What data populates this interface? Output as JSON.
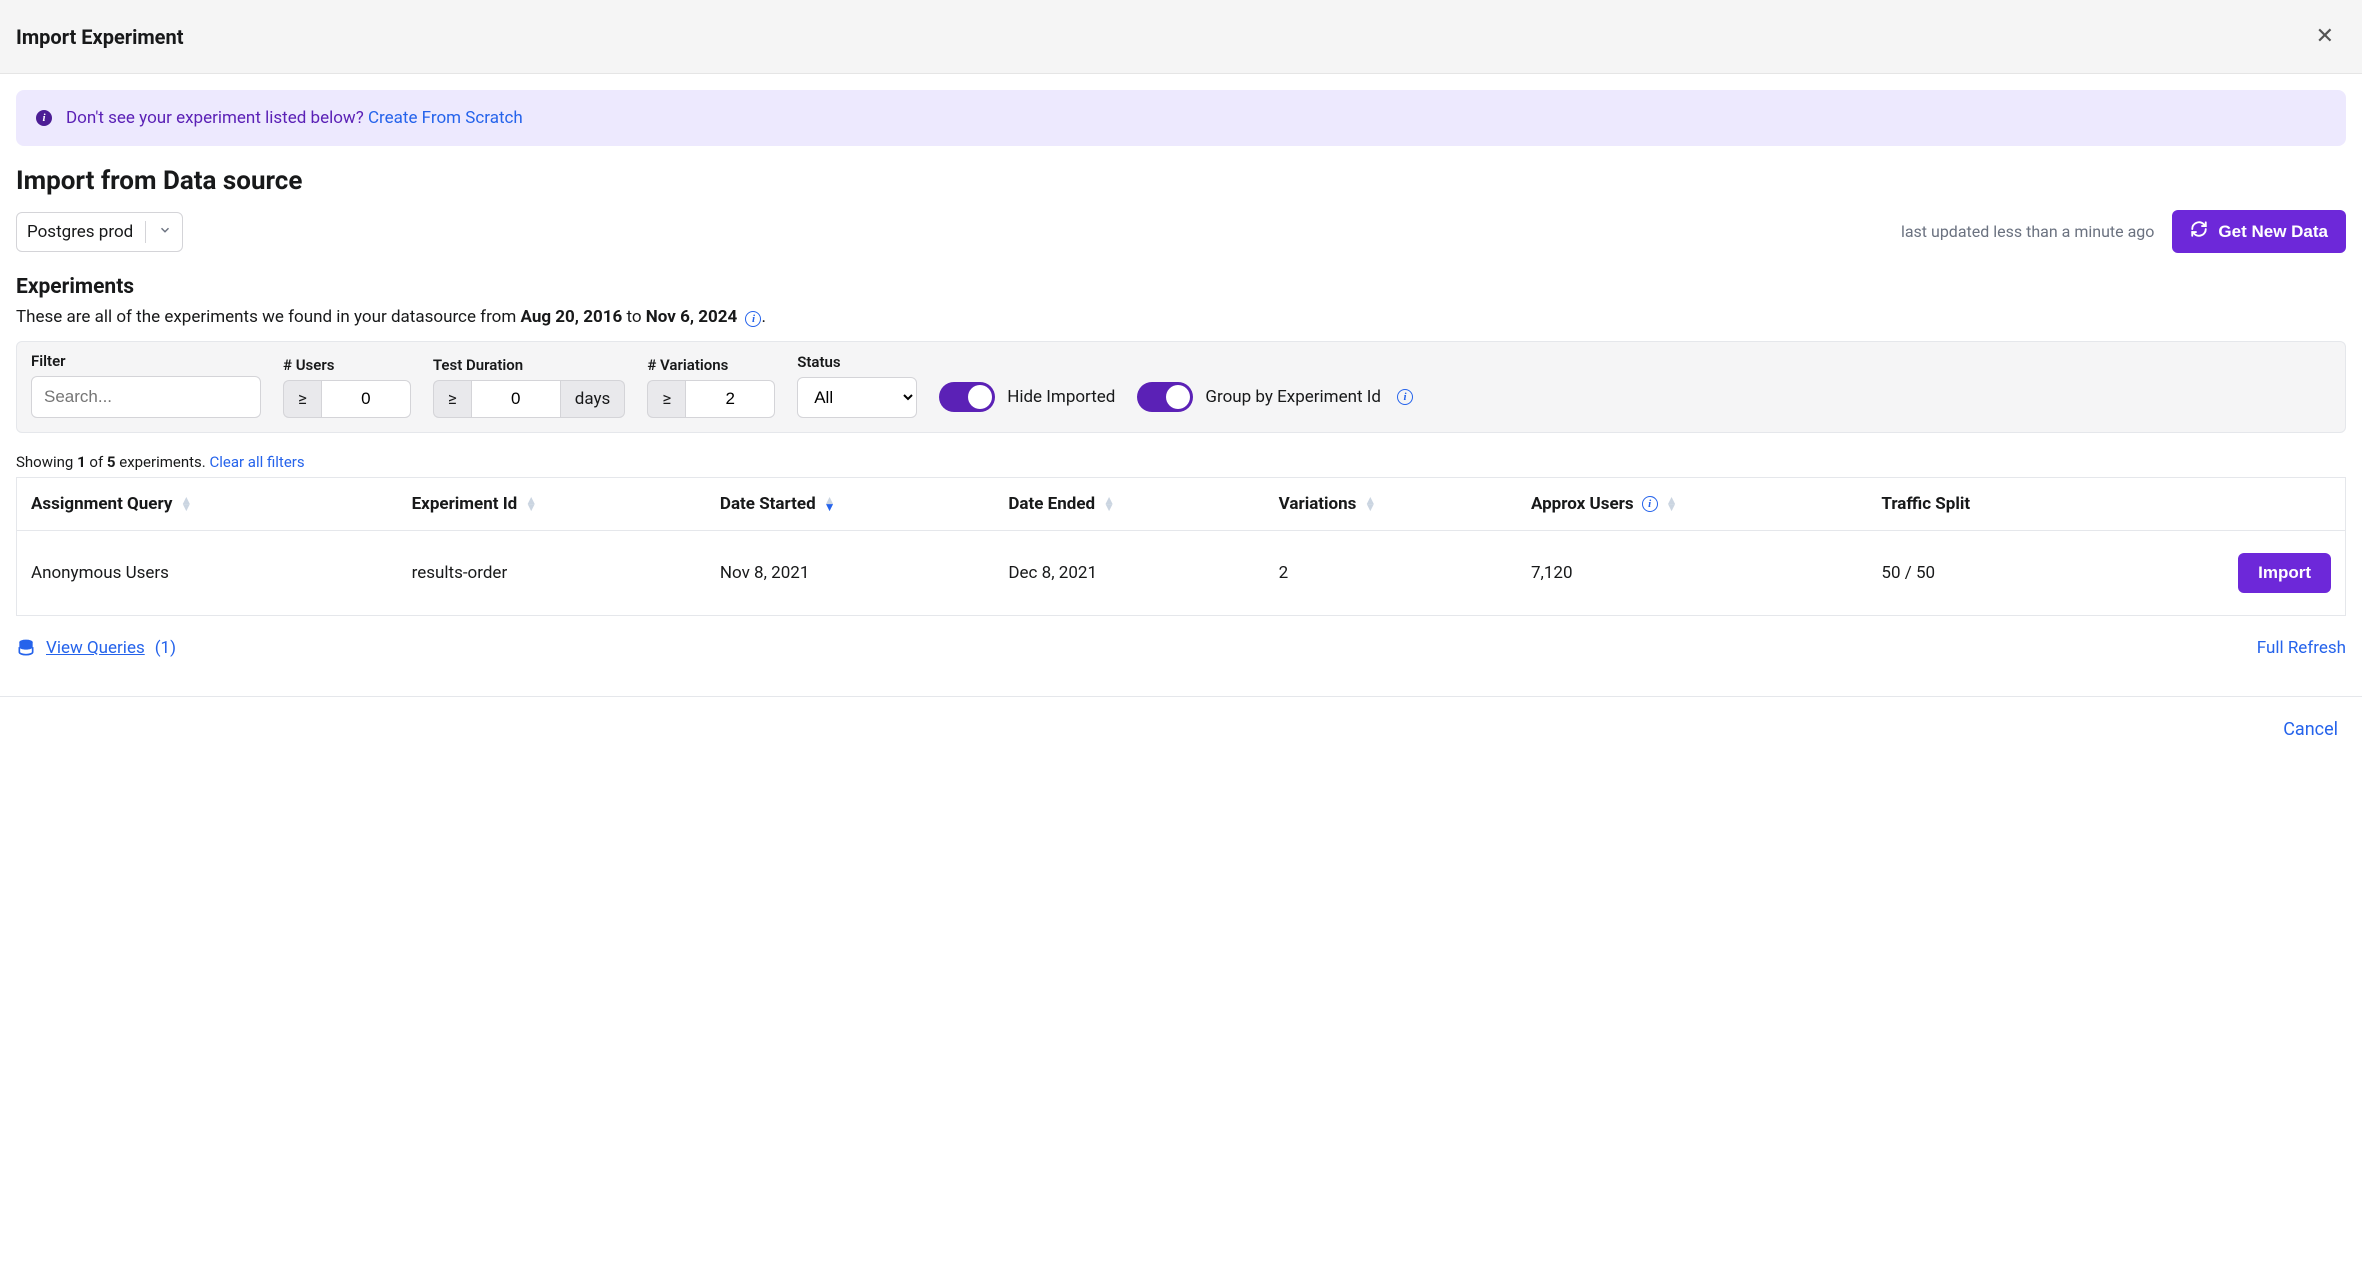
{
  "header": {
    "title": "Import Experiment"
  },
  "banner": {
    "text": "Don't see your experiment listed below?",
    "link": "Create From Scratch"
  },
  "source": {
    "title": "Import from Data source",
    "selected": "Postgres prod",
    "last_updated": "last updated less than a minute ago",
    "get_new": "Get New Data"
  },
  "experiments": {
    "title": "Experiments",
    "desc_prefix": "These are all of the experiments we found in your datasource from ",
    "date_from": "Aug 20, 2016",
    "desc_mid": " to ",
    "date_to": "Nov 6, 2024",
    "desc_suffix": " "
  },
  "filter": {
    "filter_label": "Filter",
    "search_placeholder": "Search...",
    "users_label": "# Users",
    "users_op": "≥",
    "users_val": "0",
    "duration_label": "Test Duration",
    "duration_op": "≥",
    "duration_val": "0",
    "duration_unit": "days",
    "variations_label": "# Variations",
    "variations_op": "≥",
    "variations_val": "2",
    "status_label": "Status",
    "status_val": "All",
    "hide_imported": "Hide Imported",
    "group_by": "Group by Experiment Id"
  },
  "showing": {
    "prefix": "Showing ",
    "n": "1",
    "mid": " of ",
    "total": "5",
    "suffix": " experiments. ",
    "clear": "Clear all filters"
  },
  "table": {
    "headers": {
      "assignment_query": "Assignment Query",
      "experiment_id": "Experiment Id",
      "date_started": "Date Started",
      "date_ended": "Date Ended",
      "variations": "Variations",
      "approx_users": "Approx Users",
      "traffic_split": "Traffic Split"
    },
    "rows": [
      {
        "assignment_query": "Anonymous Users",
        "experiment_id": "results-order",
        "date_started": "Nov 8, 2021",
        "date_ended": "Dec 8, 2021",
        "variations": "2",
        "approx_users": "7,120",
        "traffic_split": "50 / 50",
        "action": "Import"
      }
    ]
  },
  "footer": {
    "view_queries": "View Queries",
    "view_queries_count": "(1)",
    "full_refresh": "Full Refresh",
    "cancel": "Cancel"
  }
}
